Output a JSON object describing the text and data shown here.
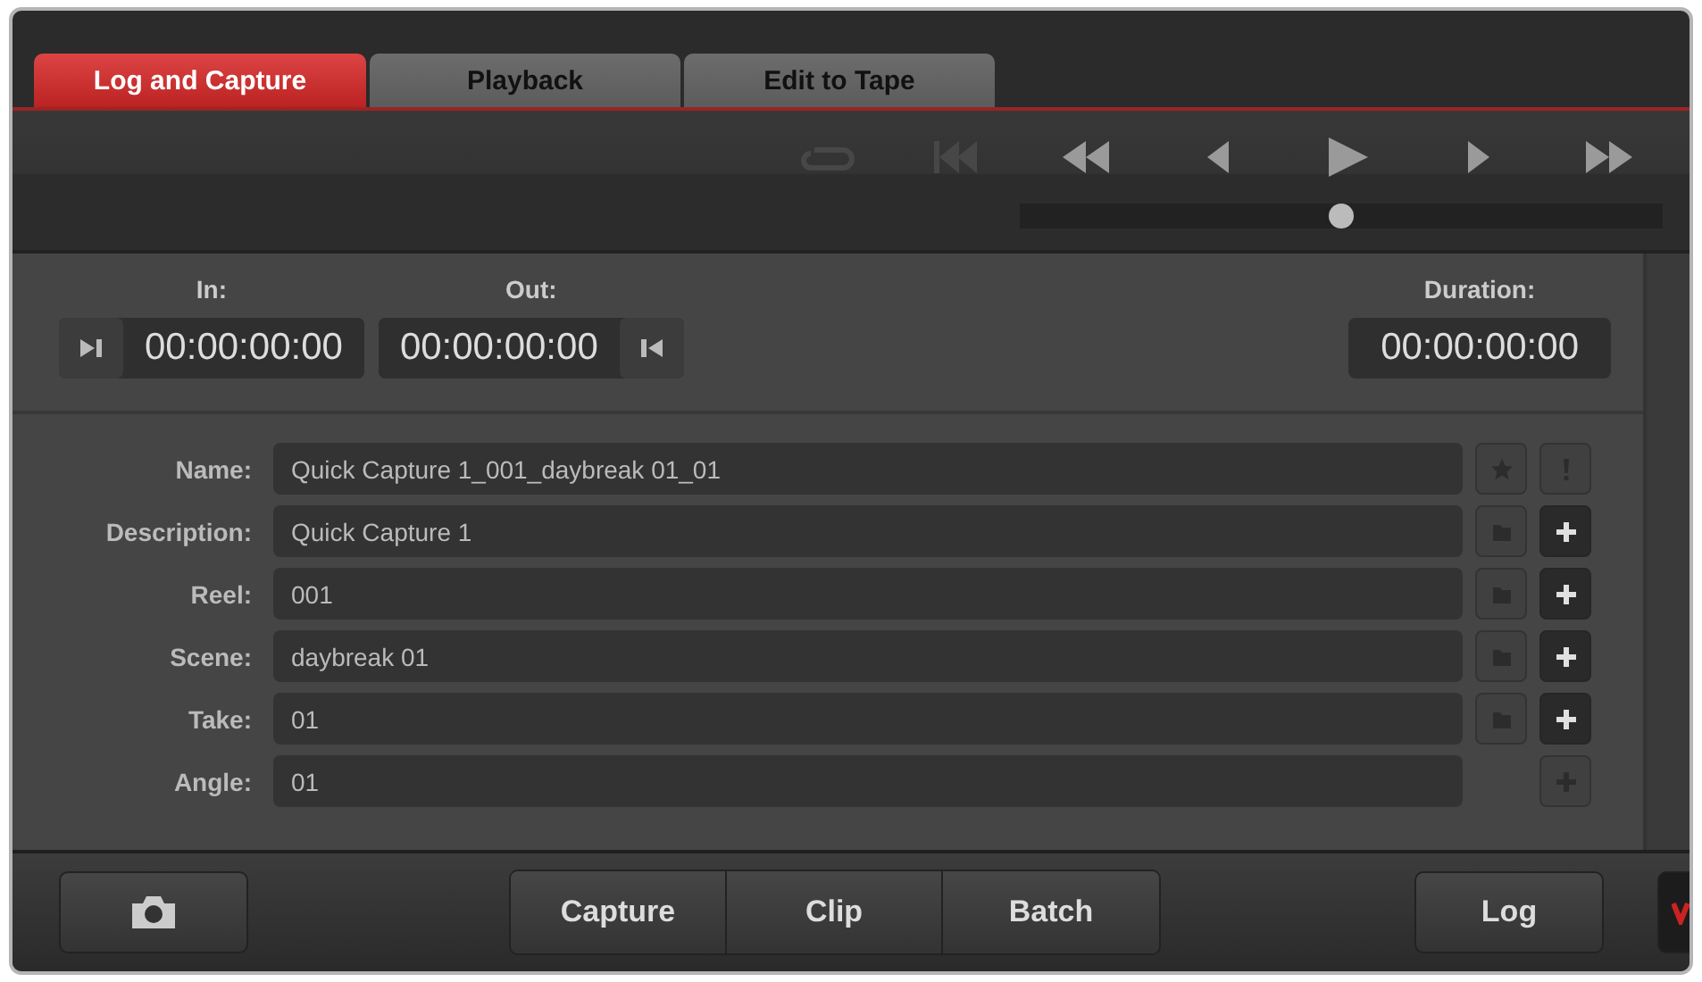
{
  "tabs": [
    {
      "label": "Log and Capture",
      "selected": true
    },
    {
      "label": "Playback",
      "selected": false
    },
    {
      "label": "Edit to Tape",
      "selected": false
    }
  ],
  "transport": [
    {
      "kind": "loop",
      "disabled": true
    },
    {
      "kind": "start",
      "disabled": true
    },
    {
      "kind": "rewind",
      "disabled": false
    },
    {
      "kind": "back",
      "disabled": false
    },
    {
      "kind": "play",
      "disabled": false
    },
    {
      "kind": "forward",
      "disabled": false
    },
    {
      "kind": "fastforward",
      "disabled": false
    }
  ],
  "scrubber": {
    "level": 0.5
  },
  "timecodes": {
    "in": {
      "label": "In:",
      "value": "00:00:00:00"
    },
    "out": {
      "label": "Out:",
      "value": "00:00:00:00"
    },
    "duration": {
      "label": "Duration:",
      "value": "00:00:00:00"
    }
  },
  "fields": [
    {
      "label": "Name:",
      "value": "Quick Capture 1_001_daybreak 01_01",
      "actions": [
        {
          "kind": "star",
          "disabled": true
        },
        {
          "kind": "alert",
          "disabled": true
        }
      ]
    },
    {
      "label": "Description:",
      "value": "Quick Capture 1",
      "actions": [
        {
          "kind": "folder",
          "disabled": true
        },
        {
          "kind": "plus",
          "disabled": false
        }
      ]
    },
    {
      "label": "Reel:",
      "value": "001",
      "actions": [
        {
          "kind": "folder",
          "disabled": true
        },
        {
          "kind": "plus",
          "disabled": false
        }
      ]
    },
    {
      "label": "Scene:",
      "value": "daybreak 01",
      "actions": [
        {
          "kind": "folder",
          "disabled": true
        },
        {
          "kind": "plus",
          "disabled": false
        }
      ]
    },
    {
      "label": "Take:",
      "value": "01",
      "actions": [
        {
          "kind": "folder",
          "disabled": true
        },
        {
          "kind": "plus",
          "disabled": false
        }
      ]
    },
    {
      "label": "Angle:",
      "value": "01",
      "actions": [
        {
          "kind": "plus",
          "disabled": true
        }
      ]
    }
  ],
  "bottom_bar": {
    "capture_group": [
      "Capture",
      "Clip",
      "Batch"
    ],
    "log": "Log"
  }
}
